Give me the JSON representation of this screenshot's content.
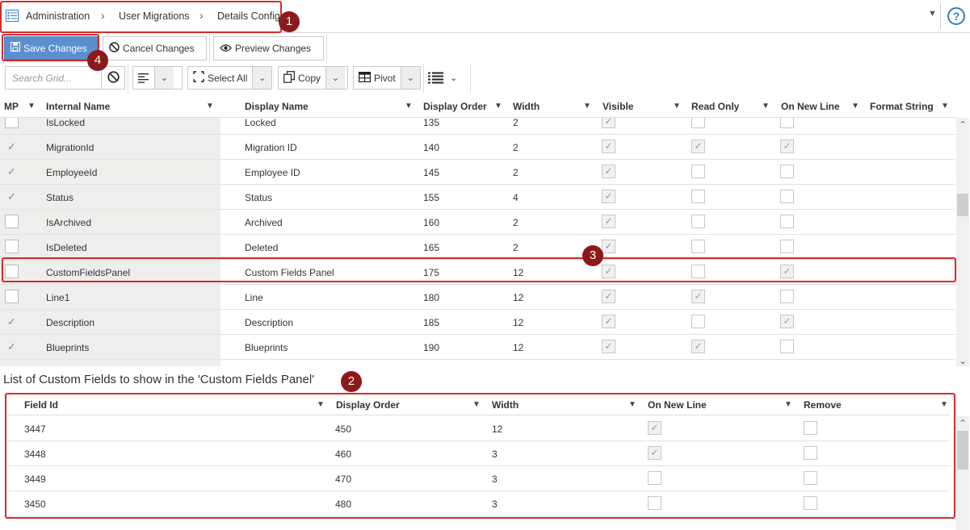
{
  "breadcrumb": [
    "Administration",
    "User Migrations",
    "Details Config"
  ],
  "markers": [
    "1",
    "2",
    "3",
    "4"
  ],
  "toolbar": {
    "save": "Save Changes",
    "cancel": "Cancel Changes",
    "preview": "Preview Changes",
    "search_placeholder": "Search Grid...",
    "select_all": "Select All",
    "copy": "Copy",
    "pivot": "Pivot"
  },
  "grid": {
    "columns": [
      "MP",
      "Internal Name",
      "Display Name",
      "Display Order",
      "Width",
      "Visible",
      "Read Only",
      "On New Line",
      "Format String"
    ],
    "rows": [
      {
        "mp": false,
        "internal": "IsLocked",
        "display": "Locked",
        "order": "135",
        "width": "2",
        "visible": true,
        "readonly": false,
        "newline": false
      },
      {
        "mp": true,
        "internal": "MigrationId",
        "display": "Migration ID",
        "order": "140",
        "width": "2",
        "visible": true,
        "readonly": true,
        "newline": true
      },
      {
        "mp": true,
        "internal": "EmployeeId",
        "display": "Employee ID",
        "order": "145",
        "width": "2",
        "visible": true,
        "readonly": false,
        "newline": false
      },
      {
        "mp": true,
        "internal": "Status",
        "display": "Status",
        "order": "155",
        "width": "4",
        "visible": true,
        "readonly": false,
        "newline": false
      },
      {
        "mp": false,
        "internal": "IsArchived",
        "display": "Archived",
        "order": "160",
        "width": "2",
        "visible": true,
        "readonly": false,
        "newline": false
      },
      {
        "mp": false,
        "internal": "IsDeleted",
        "display": "Deleted",
        "order": "165",
        "width": "2",
        "visible": true,
        "readonly": false,
        "newline": false
      },
      {
        "mp": false,
        "internal": "CustomFieldsPanel",
        "display": "Custom Fields Panel",
        "order": "175",
        "width": "12",
        "visible": true,
        "readonly": false,
        "newline": true
      },
      {
        "mp": false,
        "internal": "Line1",
        "display": "Line",
        "order": "180",
        "width": "12",
        "visible": true,
        "readonly": true,
        "newline": false
      },
      {
        "mp": true,
        "internal": "Description",
        "display": "Description",
        "order": "185",
        "width": "12",
        "visible": true,
        "readonly": false,
        "newline": true
      },
      {
        "mp": true,
        "internal": "Blueprints",
        "display": "Blueprints",
        "order": "190",
        "width": "12",
        "visible": true,
        "readonly": true,
        "newline": false
      }
    ]
  },
  "custom_panel": {
    "title": "List of Custom Fields to show in the 'Custom Fields Panel'",
    "columns": [
      "Field Id",
      "Display Order",
      "Width",
      "On New Line",
      "Remove"
    ],
    "rows": [
      {
        "field_id": "3447",
        "order": "450",
        "width": "12",
        "newline": true,
        "remove": false
      },
      {
        "field_id": "3448",
        "order": "460",
        "width": "3",
        "newline": true,
        "remove": false
      },
      {
        "field_id": "3449",
        "order": "470",
        "width": "3",
        "newline": false,
        "remove": false
      },
      {
        "field_id": "3450",
        "order": "480",
        "width": "3",
        "newline": false,
        "remove": false
      }
    ]
  }
}
